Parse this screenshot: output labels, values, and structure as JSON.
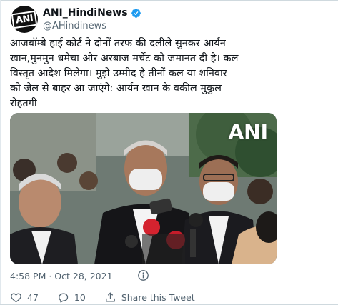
{
  "author": {
    "name": "ANI_HindiNews",
    "handle": "@AHindinews",
    "avatar_text": "ANI"
  },
  "tweet": {
    "lines": [
      "आजबॉम्बे हाई कोर्ट ने दोनों तरफ की दलीले सुनकर आर्यन",
      "खान,मुनमुन धमेचा और अरबाज मर्चेंट को जमानत दी है। कल",
      "विस्तृत आदेश मिलेगा। मुझे उम्मीद है तीनों कल या शनिवार",
      "को जेल से बाहर आ जाएंगे: आर्यन खान के वकील मुकुल",
      "रोहतगी"
    ],
    "media_watermark": "ANI",
    "timestamp": "4:58 PM · Oct 28, 2021"
  },
  "actions": {
    "likes": "47",
    "replies": "10",
    "share_label": "Share this Tweet"
  },
  "colors": {
    "verified": "#1d9bf0",
    "like": "#f91880",
    "muted": "#536471"
  },
  "icons": [
    "verified-badge-icon",
    "info-icon",
    "heart-icon",
    "reply-icon",
    "share-icon"
  ]
}
